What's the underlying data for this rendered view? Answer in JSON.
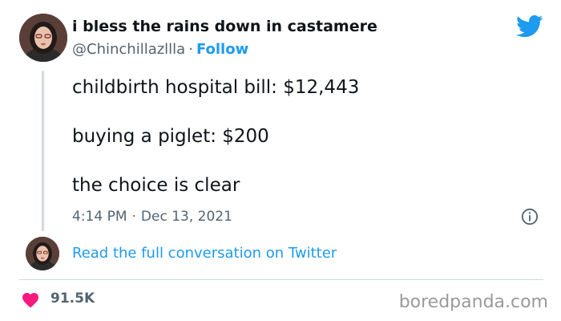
{
  "author": {
    "display_name": "i bless the rains down in castamere",
    "handle": "@Chinchillazllla",
    "separator": "·",
    "follow_label": "Follow"
  },
  "tweet": {
    "lines": [
      "childbirth hospital bill: $12,443",
      "buying a piglet: $200",
      "the choice is clear"
    ],
    "time": "4:14 PM",
    "date_separator": "·",
    "date": "Dec 13, 2021"
  },
  "read_more_label": "Read the full conversation on Twitter",
  "likes": "91.5K",
  "watermark": "boredpanda.com",
  "icons": {
    "brand": "twitter-bird-icon",
    "info": "info-icon",
    "like": "heart-icon"
  },
  "colors": {
    "accent": "#1d9bf0",
    "text": "#0f1419",
    "muted": "#536471",
    "heart": "#f91880",
    "divider": "#cfd9de",
    "watermark": "#9a9a9a"
  }
}
